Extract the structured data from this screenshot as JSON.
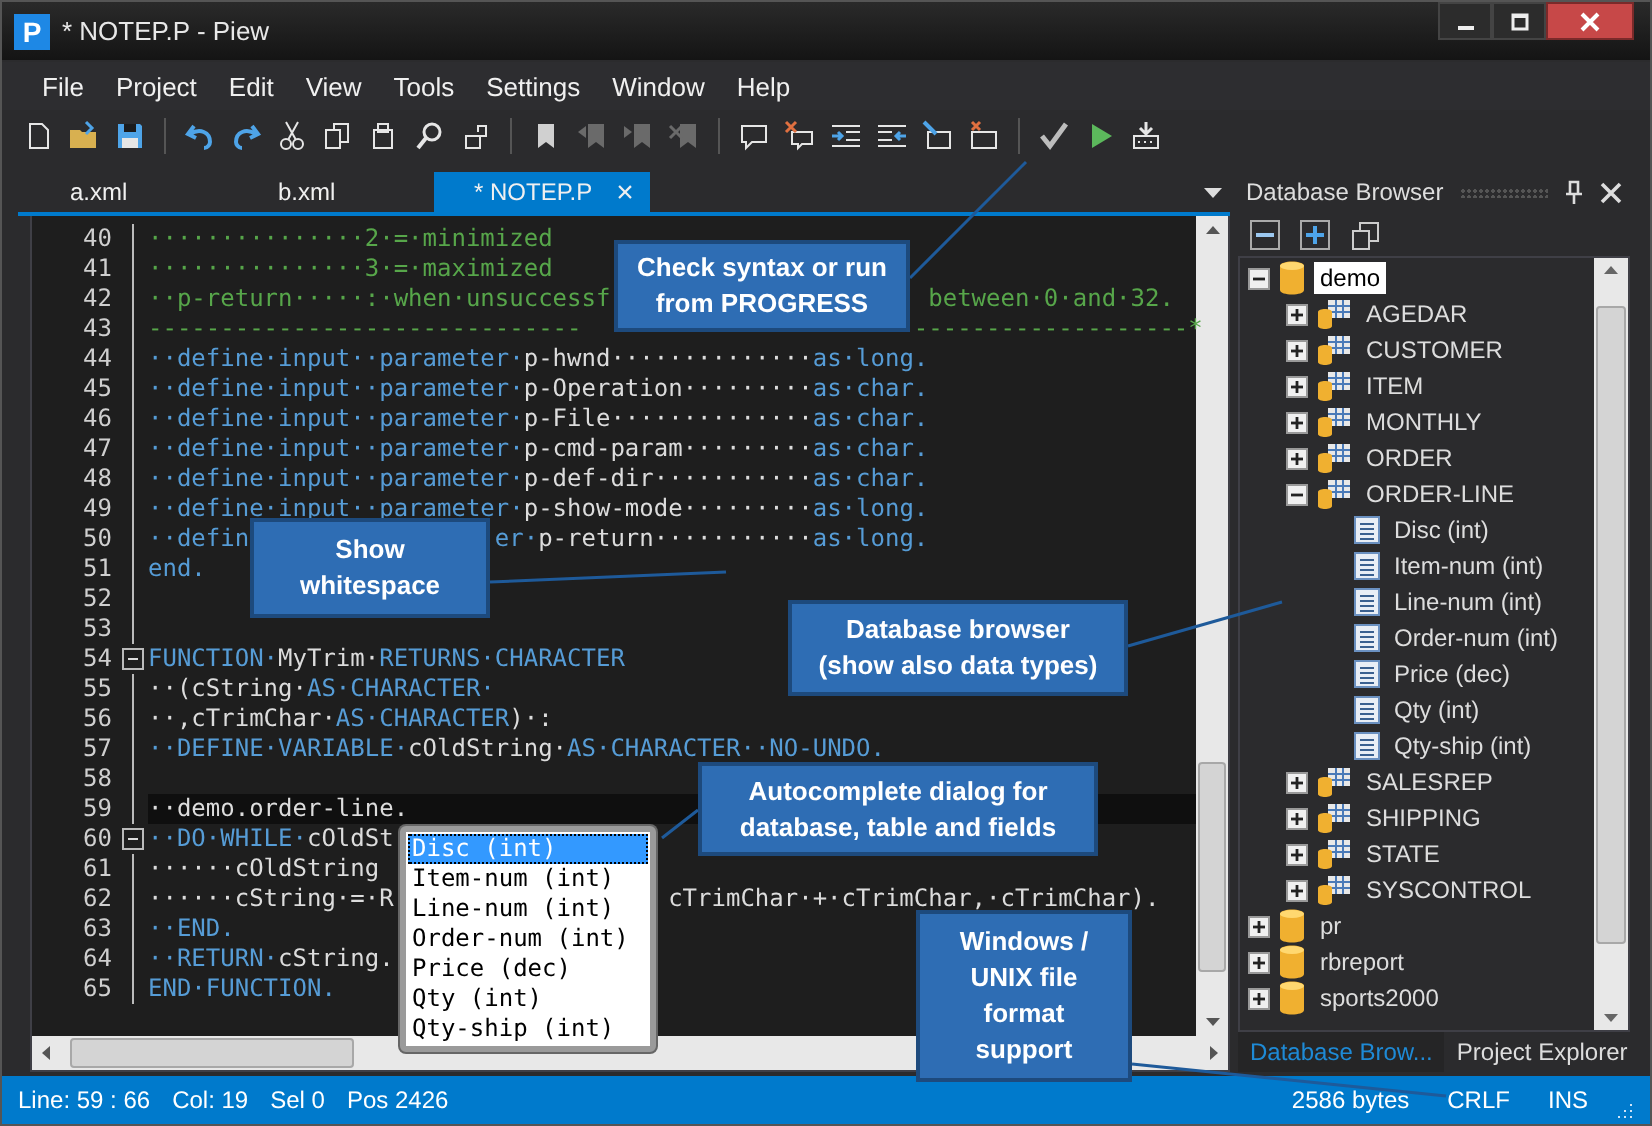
{
  "window": {
    "app_icon": "P",
    "title": "* NOTEP.P - Piew"
  },
  "menu": [
    "File",
    "Project",
    "Edit",
    "View",
    "Tools",
    "Settings",
    "Window",
    "Help"
  ],
  "tabs": [
    {
      "label": "a.xml",
      "selected": false
    },
    {
      "label": "b.xml",
      "selected": false
    },
    {
      "label": "* NOTEP.P",
      "selected": true,
      "close": "×"
    }
  ],
  "code": {
    "lines": [
      {
        "number": "40",
        "collapsible": false,
        "fragments": [
          {
            "segments": [
              {
                "kind": "comment",
                "text": "···············2·=·minimized"
              }
            ]
          }
        ]
      },
      {
        "number": "41",
        "collapsible": false,
        "fragments": [
          {
            "segments": [
              {
                "kind": "comment",
                "text": "···············3·=·maximized"
              }
            ]
          }
        ]
      },
      {
        "number": "42",
        "collapsible": false,
        "fragments": [
          {
            "segments": [
              {
                "kind": "comment",
                "text": "··p-return·····:·when·unsuccessf"
              }
            ]
          },
          {
            "segments": [
              {
                "kind": "comment",
                "text": "between·0·and·32."
              }
            ]
          }
        ]
      },
      {
        "number": "43",
        "collapsible": false,
        "fragments": [
          {
            "segments": [
              {
                "kind": "comment",
                "text": "------------------------------"
              }
            ]
          },
          {
            "segments": [
              {
                "kind": "comment",
                "text": "-------------------*"
              }
            ]
          }
        ]
      },
      {
        "number": "44",
        "collapsible": false,
        "fragments": [
          {
            "segments": [
              {
                "kind": "keyword",
                "text": "··define·input··parameter·"
              },
              {
                "kind": "plain",
                "text": "p-hwnd··············"
              },
              {
                "kind": "keyword",
                "text": "as·long."
              }
            ]
          }
        ]
      },
      {
        "number": "45",
        "collapsible": false,
        "fragments": [
          {
            "segments": [
              {
                "kind": "keyword",
                "text": "··define·input··parameter·"
              },
              {
                "kind": "plain",
                "text": "p-Operation·········"
              },
              {
                "kind": "keyword",
                "text": "as·char."
              }
            ]
          }
        ]
      },
      {
        "number": "46",
        "collapsible": false,
        "fragments": [
          {
            "segments": [
              {
                "kind": "keyword",
                "text": "··define·input··parameter·"
              },
              {
                "kind": "plain",
                "text": "p-File··············"
              },
              {
                "kind": "keyword",
                "text": "as·char."
              }
            ]
          }
        ]
      },
      {
        "number": "47",
        "collapsible": false,
        "fragments": [
          {
            "segments": [
              {
                "kind": "keyword",
                "text": "··define·input··parameter·"
              },
              {
                "kind": "plain",
                "text": "p-cmd-param·········"
              },
              {
                "kind": "keyword",
                "text": "as·char."
              }
            ]
          }
        ]
      },
      {
        "number": "48",
        "collapsible": false,
        "fragments": [
          {
            "segments": [
              {
                "kind": "keyword",
                "text": "··define·input··parameter·"
              },
              {
                "kind": "plain",
                "text": "p-def-dir···········"
              },
              {
                "kind": "keyword",
                "text": "as·char."
              }
            ]
          }
        ]
      },
      {
        "number": "49",
        "collapsible": false,
        "fragments": [
          {
            "segments": [
              {
                "kind": "keyword",
                "text": "··define·input··parameter·"
              },
              {
                "kind": "plain",
                "text": "p-show-mode·········"
              },
              {
                "kind": "keyword",
                "text": "as·long."
              }
            ]
          }
        ]
      },
      {
        "number": "50",
        "collapsible": false,
        "fragments": [
          {
            "segments": [
              {
                "kind": "keyword",
                "text": "··defin"
              }
            ]
          },
          {
            "segments": [
              {
                "kind": "keyword",
                "text": "er·"
              },
              {
                "kind": "plain",
                "text": "p-return···········"
              },
              {
                "kind": "keyword",
                "text": "as·long."
              }
            ]
          }
        ]
      },
      {
        "number": "51",
        "collapsible": false,
        "fragments": [
          {
            "segments": [
              {
                "kind": "keyword",
                "text": "end."
              }
            ]
          }
        ]
      },
      {
        "number": "52",
        "collapsible": false
      },
      {
        "number": "53",
        "collapsible": false
      },
      {
        "number": "54",
        "collapsible": true,
        "fragments": [
          {
            "segments": [
              {
                "kind": "keyword",
                "text": "FUNCTION·"
              },
              {
                "kind": "plain",
                "text": "MyTrim·"
              },
              {
                "kind": "keyword",
                "text": "RETURNS·CHARACTER"
              }
            ]
          }
        ]
      },
      {
        "number": "55",
        "collapsible": false,
        "fragments": [
          {
            "segments": [
              {
                "kind": "plain",
                "text": "··(cString·"
              },
              {
                "kind": "keyword",
                "text": "AS·CHARACTER·"
              }
            ]
          }
        ]
      },
      {
        "number": "56",
        "collapsible": false,
        "fragments": [
          {
            "segments": [
              {
                "kind": "plain",
                "text": "··,cTrimChar·"
              },
              {
                "kind": "keyword",
                "text": "AS·CHARACTER"
              },
              {
                "kind": "plain",
                "text": ")·:"
              }
            ]
          }
        ]
      },
      {
        "number": "57",
        "collapsible": false,
        "fragments": [
          {
            "segments": [
              {
                "kind": "keyword",
                "text": "··DEFINE·VARIABLE·"
              },
              {
                "kind": "plain",
                "text": "cOldString·"
              },
              {
                "kind": "keyword",
                "text": "AS·CHARACTER··NO-UNDO."
              }
            ]
          }
        ]
      },
      {
        "number": "58",
        "collapsible": false
      },
      {
        "number": "59",
        "collapsible": false,
        "current": true,
        "fragments": [
          {
            "segments": [
              {
                "kind": "plain",
                "text": "··demo.order-line."
              }
            ]
          }
        ]
      },
      {
        "number": "60",
        "collapsible": true,
        "fragments": [
          {
            "segments": [
              {
                "kind": "keyword",
                "text": "··DO·WHILE·"
              },
              {
                "kind": "plain",
                "text": "cOldSt"
              }
            ]
          }
        ]
      },
      {
        "number": "61",
        "collapsible": false,
        "fragments": [
          {
            "segments": [
              {
                "kind": "plain",
                "text": "······cOldString"
              }
            ]
          }
        ]
      },
      {
        "number": "62",
        "collapsible": false,
        "fragments": [
          {
            "segments": [
              {
                "kind": "plain",
                "text": "······cString·=·R"
              }
            ]
          },
          {
            "segments": [
              {
                "kind": "plain",
                "text": "cTrimChar·+·cTrimChar,·cTrimChar)."
              }
            ]
          }
        ]
      },
      {
        "number": "63",
        "collapsible": false,
        "fragments": [
          {
            "segments": [
              {
                "kind": "keyword",
                "text": "··END."
              }
            ]
          }
        ]
      },
      {
        "number": "64",
        "collapsible": false,
        "fragments": [
          {
            "segments": [
              {
                "kind": "keyword",
                "text": "··RETURN·"
              },
              {
                "kind": "plain",
                "text": "cString."
              }
            ]
          }
        ]
      },
      {
        "number": "65",
        "collapsible": false,
        "fragments": [
          {
            "segments": [
              {
                "kind": "keyword",
                "text": "END·FUNCTION."
              }
            ]
          }
        ]
      }
    ]
  },
  "autocomplete": [
    {
      "label": "Disc (int)",
      "selected": true
    },
    {
      "label": "Item-num (int)",
      "selected": false
    },
    {
      "label": "Line-num (int)",
      "selected": false
    },
    {
      "label": "Order-num (int)",
      "selected": false
    },
    {
      "label": "Price (dec)",
      "selected": false
    },
    {
      "label": "Qty (int)",
      "selected": false
    },
    {
      "label": "Qty-ship (int)",
      "selected": false
    }
  ],
  "database_browser": {
    "title": "Database Browser",
    "tree": [
      {
        "label": "demo",
        "kind": "database",
        "expanded": true,
        "selected": true,
        "children": [
          {
            "label": "AGEDAR",
            "kind": "table",
            "expanded": false,
            "selected": false
          },
          {
            "label": "CUSTOMER",
            "kind": "table",
            "expanded": false,
            "selected": false
          },
          {
            "label": "ITEM",
            "kind": "table",
            "expanded": false,
            "selected": false
          },
          {
            "label": "MONTHLY",
            "kind": "table",
            "expanded": false,
            "selected": false
          },
          {
            "label": "ORDER",
            "kind": "table",
            "expanded": false,
            "selected": false
          },
          {
            "label": "ORDER-LINE",
            "kind": "table",
            "expanded": true,
            "selected": false,
            "children": [
              {
                "label": "Disc (int)",
                "kind": "field",
                "selected": false
              },
              {
                "label": "Item-num (int)",
                "kind": "field",
                "selected": false
              },
              {
                "label": "Line-num (int)",
                "kind": "field",
                "selected": false
              },
              {
                "label": "Order-num (int)",
                "kind": "field",
                "selected": false
              },
              {
                "label": "Price (dec)",
                "kind": "field",
                "selected": false
              },
              {
                "label": "Qty (int)",
                "kind": "field",
                "selected": false
              },
              {
                "label": "Qty-ship (int)",
                "kind": "field",
                "selected": false
              }
            ]
          },
          {
            "label": "SALESREP",
            "kind": "table",
            "expanded": false,
            "selected": false
          },
          {
            "label": "SHIPPING",
            "kind": "table",
            "expanded": false,
            "selected": false
          },
          {
            "label": "STATE",
            "kind": "table",
            "expanded": false,
            "selected": false
          },
          {
            "label": "SYSCONTROL",
            "kind": "table",
            "expanded": false,
            "selected": false
          }
        ]
      },
      {
        "label": "pr",
        "kind": "database",
        "expanded": false,
        "selected": false
      },
      {
        "label": "rbreport",
        "kind": "database",
        "expanded": false,
        "selected": false
      },
      {
        "label": "sports2000",
        "kind": "database",
        "expanded": false,
        "selected": false
      }
    ],
    "tabs": [
      {
        "label": "Database Brow...",
        "selected": true
      },
      {
        "label": "Project Explorer",
        "selected": false
      }
    ]
  },
  "status_bar": {
    "left": [
      "Line: 59 : 66",
      "Col: 19",
      "Sel 0",
      "Pos 2426"
    ],
    "right": [
      "2586 bytes",
      "CRLF",
      "INS"
    ]
  },
  "callouts": [
    {
      "text": "Check syntax or run\nfrom PROGRESS"
    },
    {
      "text": "Show\nwhitespace"
    },
    {
      "text": "Database browser\n(show also data types)"
    },
    {
      "text": "Autocomplete dialog for\ndatabase, table and fields"
    },
    {
      "text": "Windows /\nUNIX file\nformat\nsupport"
    }
  ]
}
